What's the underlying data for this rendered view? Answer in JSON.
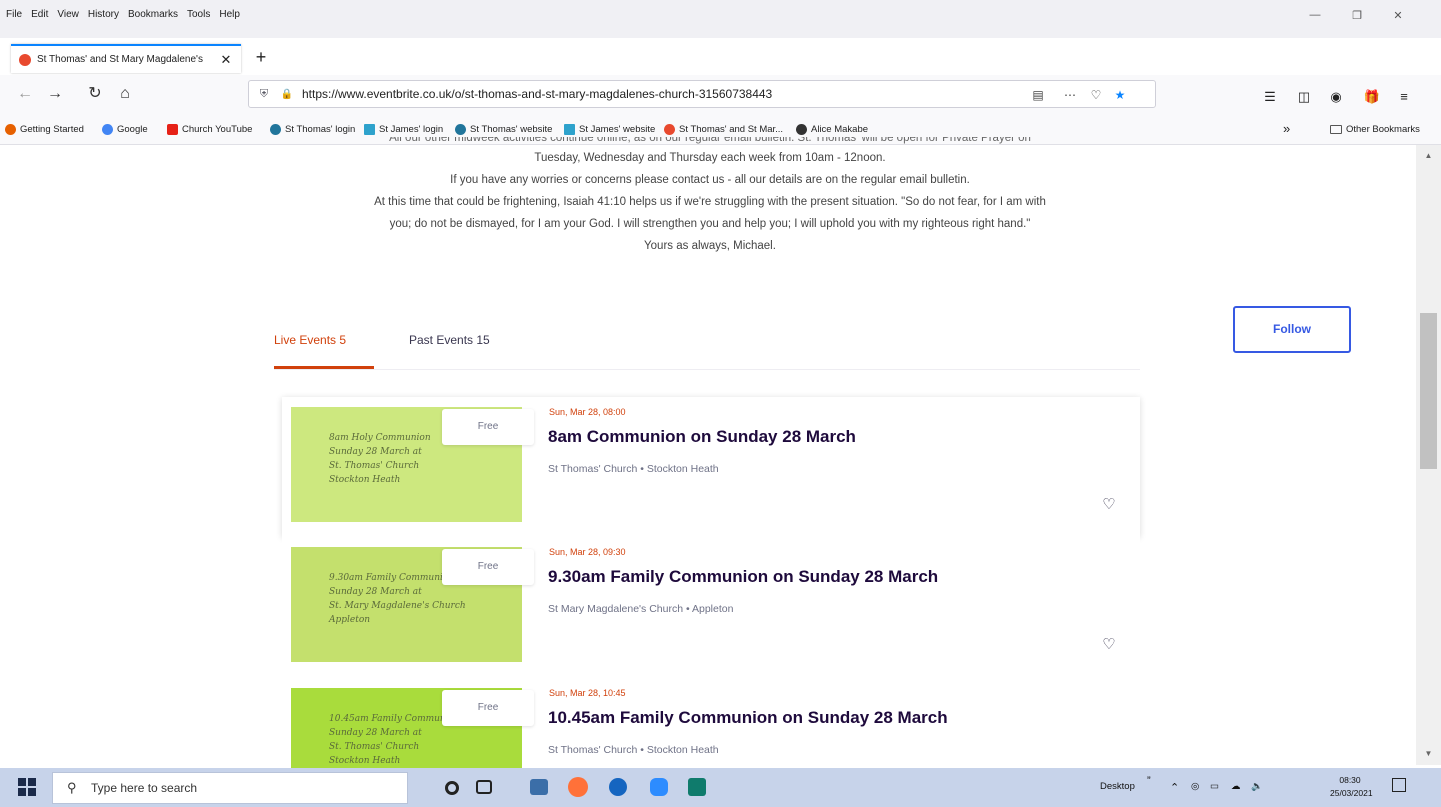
{
  "browser": {
    "menu": [
      "File",
      "Edit",
      "View",
      "History",
      "Bookmarks",
      "Tools",
      "Help"
    ],
    "tab_title": "St Thomas' and St Mary Magdalene's",
    "tab_close": "✕",
    "new_tab": "+",
    "url": "https://www.eventbrite.co.uk/o/st-thomas-and-st-mary-magdalenes-church-31560738443",
    "bookmarks": [
      {
        "label": "Getting Started",
        "color": "#e66000"
      },
      {
        "label": "Google",
        "color": "#4285f4"
      },
      {
        "label": "Church YouTube",
        "color": "#e62117"
      },
      {
        "label": "St Thomas' login",
        "color": "#21759b"
      },
      {
        "label": "St James' login",
        "color": "#2ea2cc"
      },
      {
        "label": "St Thomas' website",
        "color": "#21759b"
      },
      {
        "label": "St James' website",
        "color": "#2ea2cc"
      },
      {
        "label": "St Thomas' and St Mar...",
        "color": "#e8492e"
      },
      {
        "label": "Alice Makabe",
        "color": "#333333"
      }
    ],
    "overflow": "»",
    "other_bookmarks": "Other Bookmarks"
  },
  "page": {
    "lines": [
      "All our other midweek activities continue online, as on our regular email bulletin. St. Thomas' will be open for Private Prayer on",
      "Tuesday, Wednesday and Thursday each week from 10am - 12noon.",
      "If you have any worries or concerns please contact us - all our details are on the regular email bulletin.",
      "At this time that could be frightening, Isaiah 41:10 helps us if we're struggling with the present situation. \"So do not fear, for I am with",
      "you; do not be dismayed, for I am your God. I will strengthen you and help you; I will uphold you with my righteous right hand.\"",
      "Yours as always, Michael."
    ],
    "tabs": {
      "live": "Live Events 5",
      "past": "Past Events 15"
    },
    "follow": "Follow",
    "events": [
      {
        "date": "Sun, Mar 28, 08:00",
        "title": "8am Communion on Sunday 28 March",
        "venue": "St Thomas' Church • Stockton Heath",
        "price": "Free",
        "thumb_text": "8am Holy Communion\nSunday 28 March at\nSt. Thomas' Church\nStockton Heath",
        "thumb_color": "#cde87f"
      },
      {
        "date": "Sun, Mar 28, 09:30",
        "title": "9.30am Family Communion on Sunday 28 March",
        "venue": "St Mary Magdalene's Church • Appleton",
        "price": "Free",
        "thumb_text": "9.30am Family Communion\nSunday 28 March at\nSt. Mary Magdalene's Church\nAppleton",
        "thumb_color": "#c4e06d"
      },
      {
        "date": "Sun, Mar 28, 10:45",
        "title": "10.45am Family Communion on Sunday 28 March",
        "venue": "St Thomas' Church • Stockton Heath",
        "price": "Free",
        "thumb_text": "10.45am Family Communion\nSunday 28 March at\nSt. Thomas' Church\nStockton Heath",
        "thumb_color": "#a9dc3c"
      }
    ]
  },
  "taskbar": {
    "search_placeholder": "Type here to search",
    "desktop": "Desktop",
    "time": "08:30",
    "date": "25/03/2021"
  }
}
